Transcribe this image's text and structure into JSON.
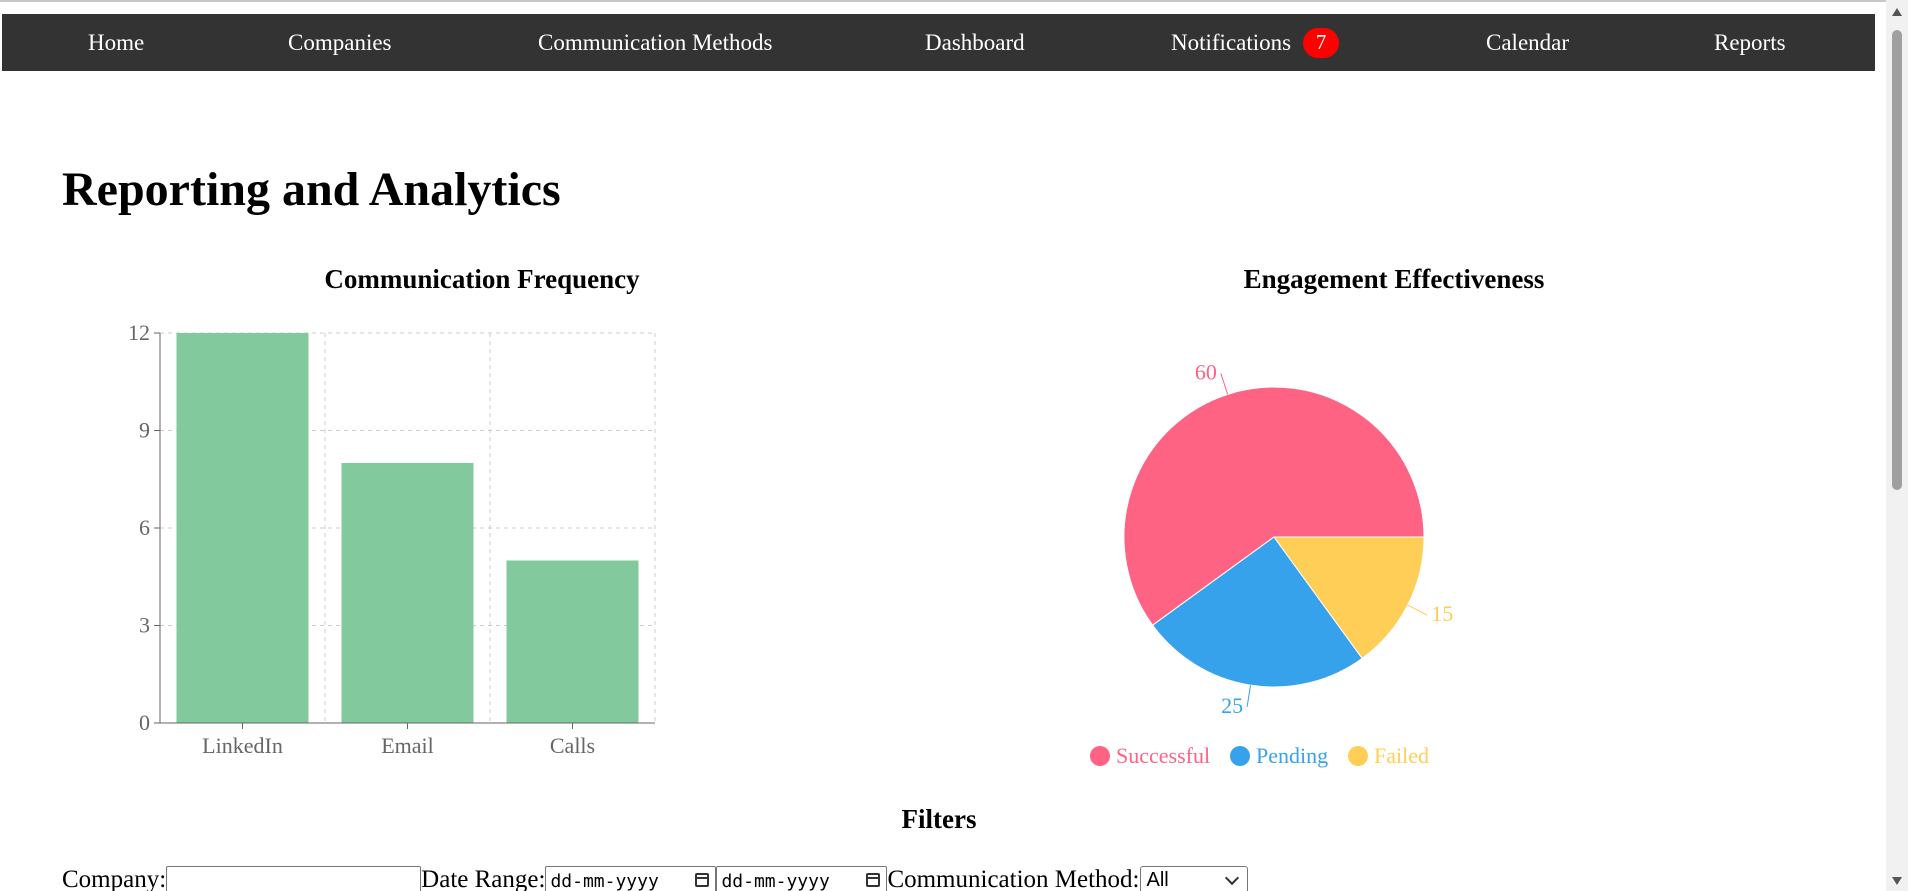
{
  "nav": {
    "items": [
      "Home",
      "Companies",
      "Communication Methods",
      "Dashboard",
      "Notifications",
      "Calendar",
      "Reports"
    ],
    "notification_count": "7"
  },
  "page_title": "Reporting and Analytics",
  "chart_data": [
    {
      "type": "bar",
      "title": "Communication Frequency",
      "categories": [
        "LinkedIn",
        "Email",
        "Calls"
      ],
      "values": [
        12,
        8,
        5
      ],
      "yticks": [
        "0",
        "3",
        "6",
        "9",
        "12"
      ],
      "ylim": [
        0,
        12
      ],
      "grid": true,
      "color": "#82ca9d"
    },
    {
      "type": "pie",
      "title": "Engagement Effectiveness",
      "labels": [
        "Successful",
        "Pending",
        "Failed"
      ],
      "values": [
        60,
        25,
        15
      ],
      "value_labels": [
        "60",
        "25",
        "15"
      ],
      "colors": [
        "#ff6384",
        "#36a2eb",
        "#ffce56"
      ],
      "legend": "bottom"
    }
  ],
  "filters": {
    "title": "Filters",
    "company_label": "Company:",
    "company_value": "",
    "date_range_label": "Date Range:",
    "date_from_placeholder": "dd-mm-yyyy",
    "date_to_placeholder": "dd-mm-yyyy",
    "method_label": "Communication Method:",
    "method_selected": "All"
  },
  "icons": [
    "calendar-icon",
    "chevron-down-icon"
  ]
}
